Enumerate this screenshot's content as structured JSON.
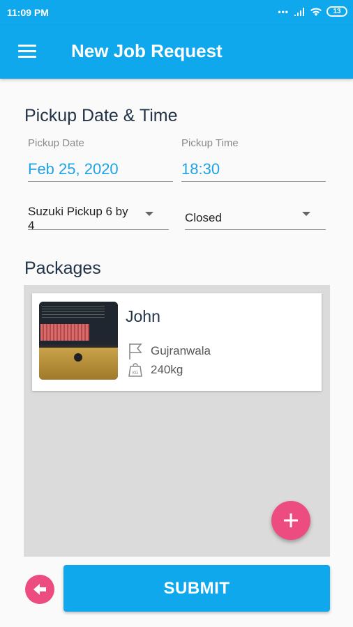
{
  "status_bar": {
    "time": "11:09 PM",
    "battery": "13"
  },
  "app_bar": {
    "title": "New Job Request"
  },
  "pickup": {
    "section_title": "Pickup Date & Time",
    "date_label": "Pickup Date",
    "date_value": "Feb 25, 2020",
    "time_label": "Pickup Time",
    "time_value": "18:30",
    "vehicle_value": "Suzuki Pickup 6 by 4",
    "body_type_value": "Closed"
  },
  "packages": {
    "section_title": "Packages",
    "items": [
      {
        "name": "John",
        "destination": "Gujranwala",
        "weight": "240kg"
      }
    ]
  },
  "actions": {
    "submit_label": "SUBMIT"
  },
  "colors": {
    "primary": "#0fa8ec",
    "accent": "#ec4c80",
    "value_text": "#1ea3e4"
  }
}
